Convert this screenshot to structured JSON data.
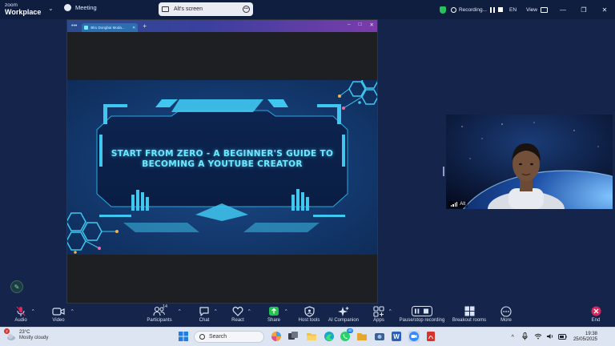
{
  "app": {
    "logo_line1": "zoom",
    "logo_line2": "Workplace",
    "meeting_label": "Meeting",
    "share_title": "Alt's screen",
    "recording_label": "Recording...",
    "language": "EN",
    "view_label": "View"
  },
  "browser": {
    "tab_title": "Blru Dongbai Moda...",
    "window_controls": [
      "–",
      "□",
      "✕"
    ]
  },
  "slide": {
    "title_line1": "Start from Zero - A Beginner's Guide to",
    "title_line2": "Becoming a YouTube Creator",
    "accent": "#4fd8ff"
  },
  "video": {
    "participant_name": "Alt"
  },
  "toolbar": {
    "items": [
      {
        "label": "Audio",
        "icon": "mic-muted-icon"
      },
      {
        "label": "Video",
        "icon": "video-camera-icon"
      },
      {
        "label": "Participants",
        "icon": "participants-icon",
        "count": "14"
      },
      {
        "label": "Chat",
        "icon": "chat-icon"
      },
      {
        "label": "React",
        "icon": "heart-icon"
      },
      {
        "label": "Share",
        "icon": "share-icon"
      },
      {
        "label": "Host tools",
        "icon": "shield-icon"
      },
      {
        "label": "AI Companion",
        "icon": "sparkle-icon"
      },
      {
        "label": "Apps",
        "icon": "apps-icon"
      },
      {
        "label": "Pause/stop recording",
        "icon": "record-controls-icon"
      },
      {
        "label": "Breakout rooms",
        "icon": "breakout-rooms-icon"
      },
      {
        "label": "More",
        "icon": "more-icon"
      },
      {
        "label": "End",
        "icon": "end-icon"
      }
    ]
  },
  "taskbar": {
    "weather_badge": "2",
    "temperature": "23°C",
    "condition": "Mostly cloudy",
    "search_placeholder": "Search",
    "chat_badge": "40",
    "time": "19:38",
    "date": "25/05/2025"
  },
  "colors": {
    "background": "#14244a",
    "topbar": "#0f1d3f",
    "share_accent": "#23c24f",
    "end_red": "#e0245e",
    "taskbar": "#dde5f2"
  }
}
